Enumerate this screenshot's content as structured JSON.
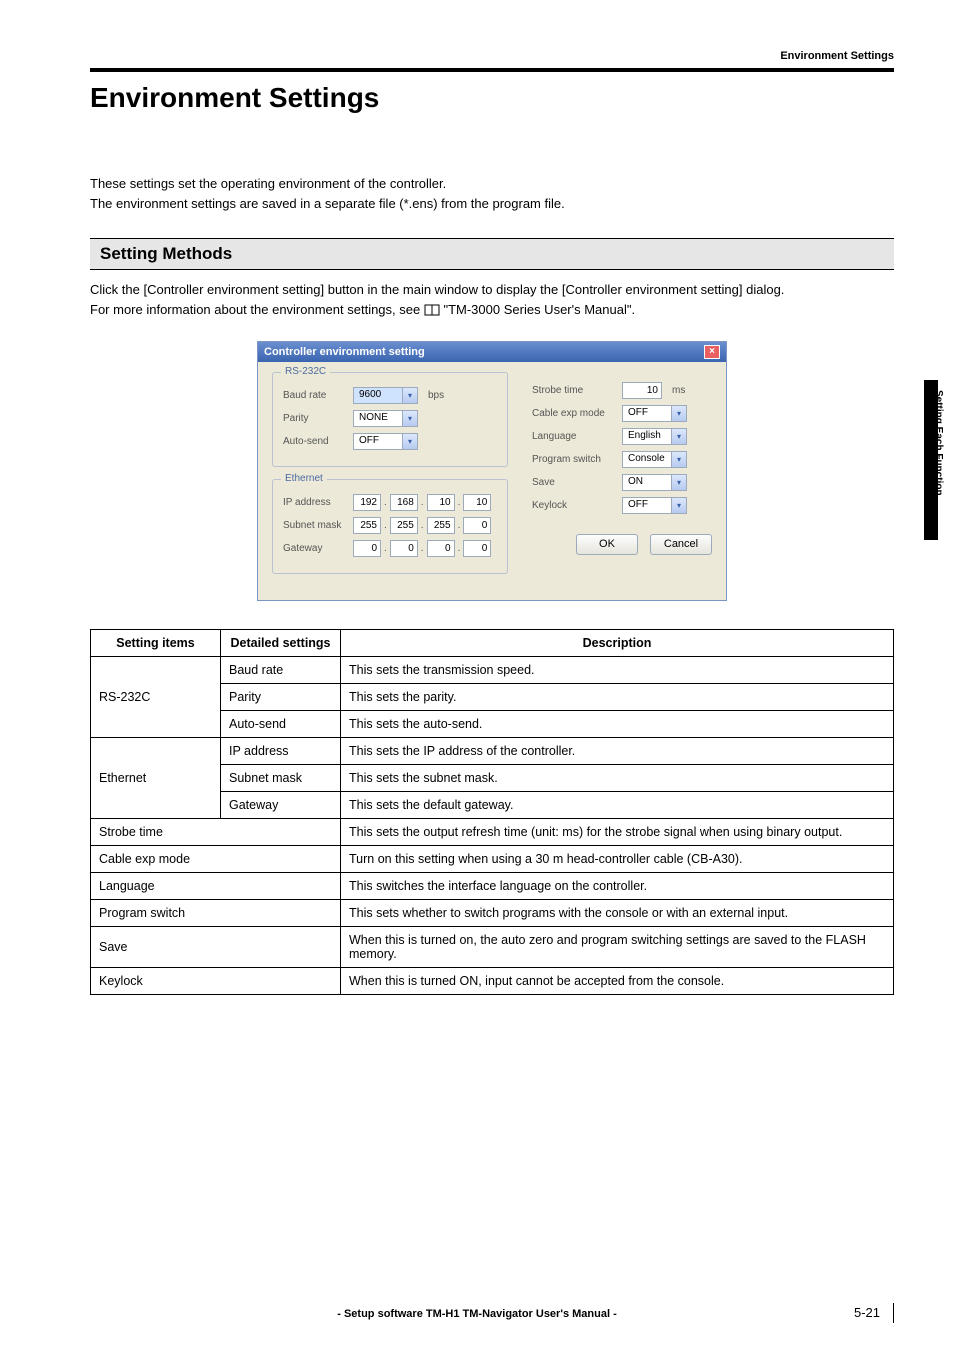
{
  "header": {
    "label": "Environment Settings"
  },
  "title": "Environment Settings",
  "intro": {
    "line1": "These settings set the operating environment of the controller.",
    "line2": "The environment settings are saved in a separate file (*.ens) from the program file."
  },
  "section": {
    "heading": "Setting Methods",
    "line1": "Click the [Controller environment setting] button in the main window to display the [Controller environment setting] dialog.",
    "line2a": "For more information about the environment settings, see ",
    "line2b": " \"TM-3000 Series User's Manual\"."
  },
  "dialog": {
    "title": "Controller environment setting",
    "close": "×",
    "rs232c": {
      "legend": "RS-232C",
      "baud_label": "Baud rate",
      "baud_value": "9600",
      "baud_unit": "bps",
      "parity_label": "Parity",
      "parity_value": "NONE",
      "autosend_label": "Auto-send",
      "autosend_value": "OFF"
    },
    "ethernet": {
      "legend": "Ethernet",
      "ip_label": "IP address",
      "ip": [
        "192",
        "168",
        "10",
        "10"
      ],
      "mask_label": "Subnet mask",
      "mask": [
        "255",
        "255",
        "255",
        "0"
      ],
      "gw_label": "Gateway",
      "gw": [
        "0",
        "0",
        "0",
        "0"
      ]
    },
    "right": {
      "strobe_label": "Strobe time",
      "strobe_value": "10",
      "strobe_unit": "ms",
      "cable_label": "Cable exp mode",
      "cable_value": "OFF",
      "lang_label": "Language",
      "lang_value": "English",
      "prog_label": "Program switch",
      "prog_value": "Console",
      "save_label": "Save",
      "save_value": "ON",
      "keylock_label": "Keylock",
      "keylock_value": "OFF"
    },
    "ok": "OK",
    "cancel": "Cancel"
  },
  "table": {
    "head": {
      "c1": "Setting items",
      "c2": "Detailed settings",
      "c3": "Description"
    },
    "rows": [
      {
        "c1": "RS-232C",
        "c2": "Baud rate",
        "c3": "This sets the transmission speed.",
        "rowspan1": 3
      },
      {
        "c2": "Parity",
        "c3": "This sets the parity."
      },
      {
        "c2": "Auto-send",
        "c3": "This sets the auto-send."
      },
      {
        "c1": "Ethernet",
        "c2": "IP address",
        "c3": "This sets the IP address of the controller.",
        "rowspan1": 3
      },
      {
        "c2": "Subnet mask",
        "c3": "This sets the subnet mask."
      },
      {
        "c2": "Gateway",
        "c3": "This sets the default gateway."
      },
      {
        "c1": "Strobe time",
        "colspan12": true,
        "c3": "This sets the output refresh time (unit: ms) for the strobe signal when using binary output."
      },
      {
        "c1": "Cable exp mode",
        "colspan12": true,
        "c3": "Turn on this setting when using a 30 m head-controller cable (CB-A30)."
      },
      {
        "c1": "Language",
        "colspan12": true,
        "c3": "This switches the interface language on the controller."
      },
      {
        "c1": "Program switch",
        "colspan12": true,
        "c3": "This sets whether to switch programs with the console or with an external input."
      },
      {
        "c1": "Save",
        "colspan12": true,
        "c3": "When this is turned on, the auto zero and program switching settings are saved to the FLASH memory."
      },
      {
        "c1": "Keylock",
        "colspan12": true,
        "c3": "When this is turned ON, input cannot be accepted from the console."
      }
    ]
  },
  "sidetab": "Setting Each Function",
  "footer": {
    "center": "- Setup software TM-H1 TM-Navigator User's Manual -",
    "page": "5-21"
  }
}
